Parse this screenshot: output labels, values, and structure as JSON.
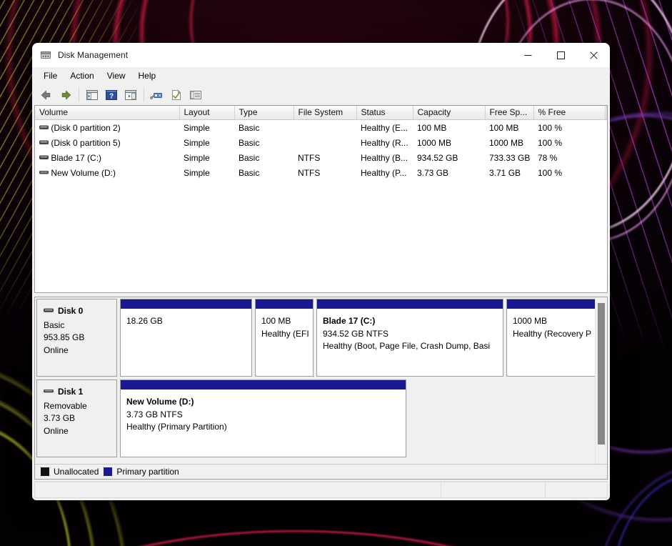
{
  "window": {
    "title": "Disk Management",
    "icon": "disk-drive-icon",
    "controls": {
      "minimize": "minimize-icon",
      "maximize": "maximize-icon",
      "close": "close-icon"
    }
  },
  "menubar": {
    "items": [
      {
        "label": "File"
      },
      {
        "label": "Action"
      },
      {
        "label": "View"
      },
      {
        "label": "Help"
      }
    ]
  },
  "toolbar": {
    "buttons": [
      {
        "name": "back-icon"
      },
      {
        "name": "forward-icon"
      },
      {
        "name": "separator"
      },
      {
        "name": "show-hide-console-tree-icon"
      },
      {
        "name": "help-icon"
      },
      {
        "name": "show-hide-action-pane-icon"
      },
      {
        "name": "separator"
      },
      {
        "name": "rescan-disks-icon"
      },
      {
        "name": "properties-icon"
      },
      {
        "name": "list-view-icon"
      }
    ]
  },
  "volume_list": {
    "columns": [
      {
        "label": "Volume"
      },
      {
        "label": "Layout"
      },
      {
        "label": "Type"
      },
      {
        "label": "File System"
      },
      {
        "label": "Status"
      },
      {
        "label": "Capacity"
      },
      {
        "label": "Free Sp..."
      },
      {
        "label": "% Free"
      },
      {
        "label": ""
      }
    ],
    "rows": [
      {
        "volume": "(Disk 0 partition 2)",
        "layout": "Simple",
        "type": "Basic",
        "file_system": "",
        "status": "Healthy (E...",
        "capacity": "100 MB",
        "free_space": "100 MB",
        "percent_free": "100 %"
      },
      {
        "volume": "(Disk 0 partition 5)",
        "layout": "Simple",
        "type": "Basic",
        "file_system": "",
        "status": "Healthy (R...",
        "capacity": "1000 MB",
        "free_space": "1000 MB",
        "percent_free": "100 %"
      },
      {
        "volume": "Blade 17 (C:)",
        "layout": "Simple",
        "type": "Basic",
        "file_system": "NTFS",
        "status": "Healthy (B...",
        "capacity": "934.52 GB",
        "free_space": "733.33 GB",
        "percent_free": "78 %"
      },
      {
        "volume": "New Volume (D:)",
        "layout": "Simple",
        "type": "Basic",
        "file_system": "NTFS",
        "status": "Healthy (P...",
        "capacity": "3.73 GB",
        "free_space": "3.71 GB",
        "percent_free": "100 %"
      }
    ]
  },
  "graphical_view": {
    "disks": [
      {
        "name": "Disk 0",
        "type": "Basic",
        "size": "953.85 GB",
        "state": "Online",
        "partitions": [
          {
            "label": "",
            "size": "18.26 GB",
            "status": "",
            "kind": "primary"
          },
          {
            "label": "",
            "size": "100 MB",
            "status": "Healthy (EFI",
            "kind": "primary"
          },
          {
            "label": "Blade 17  (C:)",
            "size": "934.52 GB NTFS",
            "status": "Healthy (Boot, Page File, Crash Dump, Basi",
            "kind": "primary"
          },
          {
            "label": "",
            "size": "1000 MB",
            "status": "Healthy (Recovery P",
            "kind": "primary"
          }
        ]
      },
      {
        "name": "Disk 1",
        "type": "Removable",
        "size": "3.73 GB",
        "state": "Online",
        "partitions": [
          {
            "label": "New Volume  (D:)",
            "size": "3.73 GB NTFS",
            "status": "Healthy (Primary Partition)",
            "kind": "primary"
          }
        ]
      }
    ]
  },
  "legend": {
    "items": [
      {
        "label": "Unallocated",
        "color": "#111111"
      },
      {
        "label": "Primary partition",
        "color": "#191993"
      }
    ]
  },
  "statusbar": {
    "cells": [
      "",
      "",
      ""
    ]
  },
  "colors": {
    "partition_blue": "#191993",
    "unallocated_black": "#111111",
    "window_chrome": "#f0f0f0",
    "pane_border": "#a0a0a0"
  }
}
